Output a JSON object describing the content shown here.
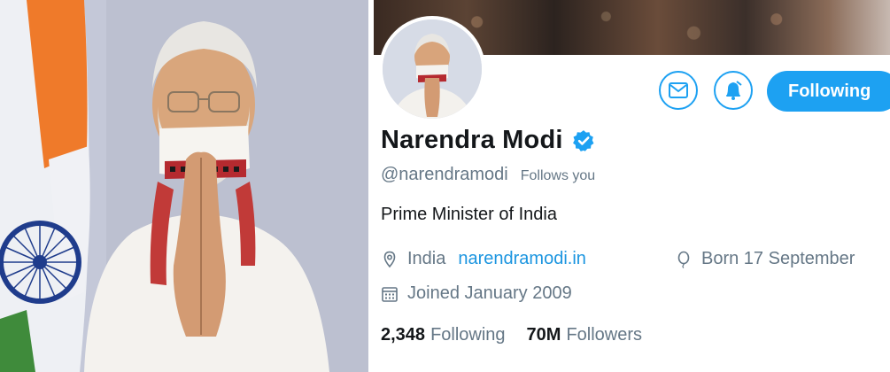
{
  "profile": {
    "display_name": "Narendra Modi",
    "handle": "@narendramodi",
    "follows_you": "Follows you",
    "bio": "Prime Minister of India",
    "location": "India",
    "website": "narendramodi.in",
    "born": "Born 17 September",
    "joined": "Joined January 2009",
    "following_count": "2,348",
    "following_label": "Following",
    "followers_count": "70M",
    "followers_label": "Followers"
  },
  "actions": {
    "follow_button_label": "Following"
  },
  "icons": {
    "mail": "mail-icon",
    "notifications": "bell-icon",
    "verified": "verified-badge-icon",
    "location": "location-pin-icon",
    "birthday": "balloon-icon",
    "calendar": "calendar-icon"
  },
  "colors": {
    "accent": "#1da1f2",
    "link": "#1b95e0",
    "text_primary": "#14171a",
    "text_secondary": "#657786"
  }
}
